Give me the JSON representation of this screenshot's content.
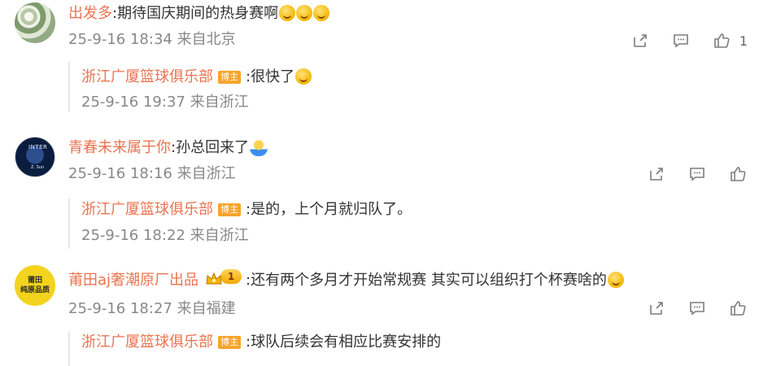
{
  "comments": [
    {
      "username": "出发多",
      "text": ":期待国庆期间的热身赛啊",
      "emoji_count": 3,
      "date": "25-9-16 18:34",
      "location": "来自北京",
      "like_count": "1",
      "reply": {
        "username": "浙江广厦篮球俱乐部",
        "badge": "博主",
        "text": ":很快了",
        "date": "25-9-16 19:37",
        "location": "来自浙江"
      }
    },
    {
      "username": "青春未来属于你",
      "text": ":孙总回来了",
      "date": "25-9-16 18:16",
      "location": "来自浙江",
      "avatar_text_top": "INTER",
      "avatar_text_bottom": "Z. Sun",
      "reply": {
        "username": "浙江广厦篮球俱乐部",
        "badge": "博主",
        "text": ":是的，上个月就归队了。",
        "date": "25-9-16 18:22",
        "location": "来自浙江"
      }
    },
    {
      "username": "莆田aj奢潮原厂出品",
      "vip_level": "1",
      "text": ":还有两个多月才开始常规赛   其实可以组织打个杯赛啥的",
      "date": "25-9-16 18:27",
      "location": "来自福建",
      "avatar_line1": "莆田",
      "avatar_line2": "纯原品质",
      "reply": {
        "username": "浙江广厦篮球俱乐部",
        "badge": "博主",
        "text": ":球队后续会有相应比赛安排的"
      }
    }
  ],
  "colors": {
    "username": "#eb7350",
    "meta": "#888888",
    "badge": "#f7a42b"
  },
  "icons": [
    "share-icon",
    "comment-icon",
    "like-icon"
  ]
}
